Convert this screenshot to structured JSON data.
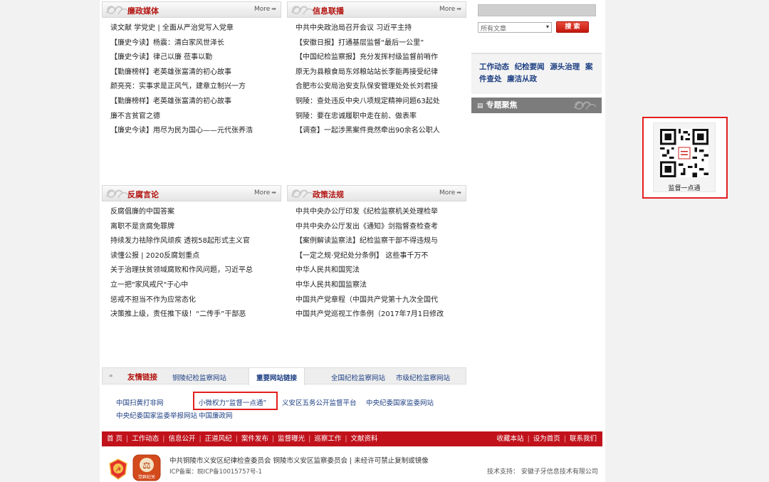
{
  "panels": {
    "lianzheng": {
      "title": "廉政媒体",
      "more": "More",
      "items": [
        "读文献 学党史 | 全面从严治党写入党章",
        "【廉史今读】杨震：清白家风世泽长",
        "【廉史今读】律己以廉 莅事以勤",
        "【勤廉榜样】老英雄张富清的初心故事",
        "颜亮亮：实事求是正风气，建章立制兴一方",
        "【勤廉榜样】老英雄张富清的初心故事",
        "廉不言贫官之德",
        "【廉史今读】用尽为民为国心——元代张养浩"
      ]
    },
    "xinxi": {
      "title": "信息联播",
      "more": "More",
      "items": [
        "中共中央政治局召开会议 习近平主持",
        "【安徽日报】打通基层监督“最后一公里”",
        "【中国纪检监察报】充分发挥村级监督前哨作",
        "原无为县粮食局东郊粮站站长李能再接受纪律",
        "合肥市公安局治安支队保安管理处处长刘君接",
        "铜陵：查处违反中央八项规定精神问题63起处",
        "铜陵：要在忠诚履职中走在前、做表率",
        "【调查】一起涉黑案件竟然牵出90余名公职人"
      ]
    },
    "fanfu": {
      "title": "反腐言论",
      "more": "More",
      "items": [
        "反腐倡廉的中国答案",
        "离职不是贪腐免罪牌",
        "持续发力祛除作风顽疾 透视58起形式主义官",
        "读懂公报 | 2020反腐划重点",
        "关于治理扶贫领域腐败和作风问题，习近平总",
        "立一把\"家风戒尺\"于心中",
        "惩戒不担当不作为应常态化",
        "决策推上级，责任推下级！“二传手”干部恶"
      ]
    },
    "zhengce": {
      "title": "政策法规",
      "more": "More",
      "items": [
        "中共中央办公厅印发《纪检监察机关处理检举",
        "中共中央办公厅发出《通知》剑指督查检查考",
        "【案例解读监察法】纪检监察干部不得违规与",
        "【一定之规·党纪处分条例】 这些事千万不",
        "中华人民共和国宪法",
        "中华人民共和国监察法",
        "中国共产党章程（中国共产党第十九次全国代",
        "中国共产党巡视工作条例（2017年7月1日修改"
      ]
    }
  },
  "sidebar": {
    "search_select": "所有文章",
    "search_button": "搜 索",
    "tags": [
      "工作动态",
      "纪检要闻",
      "源头治理",
      "案件查处",
      "廉洁从政"
    ],
    "feature_title": "专题聚焦",
    "qr_label": "监督一点通"
  },
  "links": {
    "title": "友情链接",
    "tabs": [
      "铜陵纪检监察网站",
      "重要网站链接",
      "全国纪检监察网站",
      "市级纪检监察网站"
    ],
    "row1": [
      "中国扫黄打非网",
      "小微权力“监督一点通”",
      "义安区五务公开监督平台",
      "中央纪委国家监委网站"
    ],
    "row2": [
      "中央纪委国家监委举报网站",
      "中国廉政网"
    ]
  },
  "footer": {
    "nav_left": [
      "首 页",
      "工作动态",
      "信息公开",
      "正道风纪",
      "案件发布",
      "监督曝光",
      "巡察工作",
      "文献资料"
    ],
    "nav_right": [
      "收藏本站",
      "设为首页",
      "联系我们"
    ],
    "org": "中共铜陵市义安区纪律检查委员会 铜陵市义安区监察委员会 | 未经许可禁止复制或镜像",
    "icp": "ICP备案：皖ICP备10015757号-1",
    "tech": "技术支持： 安徽子牙信息技术有限公司",
    "emblem_text": "党群纪关"
  },
  "colors": {
    "brand_red": "#c1121c",
    "title_red": "#b3130f",
    "link_blue": "#1d3f83"
  }
}
